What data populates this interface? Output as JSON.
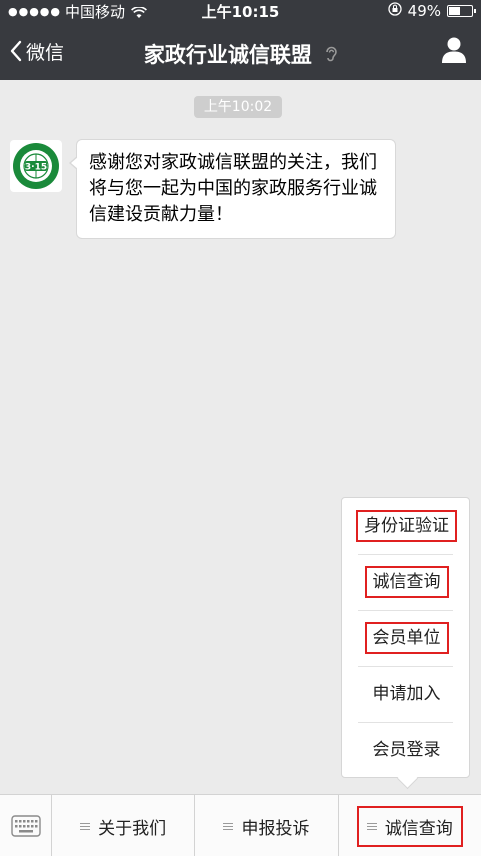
{
  "status_bar": {
    "carrier": "中国移动",
    "time": "上午10:15",
    "battery": "49%",
    "battery_level": 0.49
  },
  "nav": {
    "back_label": "微信",
    "title": "家政行业诚信联盟"
  },
  "chat": {
    "timestamp": "上午10:02",
    "avatar_text": "3·15",
    "message": "感谢您对家政诚信联盟的关注，我们将与您一起为中国的家政服务行业诚信建设贡献力量！"
  },
  "popup_menu": {
    "items": [
      {
        "label": "身份证验证"
      },
      {
        "label": "诚信查询"
      },
      {
        "label": "会员单位"
      },
      {
        "label": "申请加入"
      },
      {
        "label": "会员登录"
      }
    ]
  },
  "bottom_menu": {
    "items": [
      {
        "label": "关于我们"
      },
      {
        "label": "申报投诉"
      },
      {
        "label": "诚信查询"
      }
    ]
  },
  "colors": {
    "nav_background": "#383a3f",
    "highlight_box": "#e02020",
    "chat_background": "#ebebeb",
    "avatar_green": "#1a8a3a"
  }
}
